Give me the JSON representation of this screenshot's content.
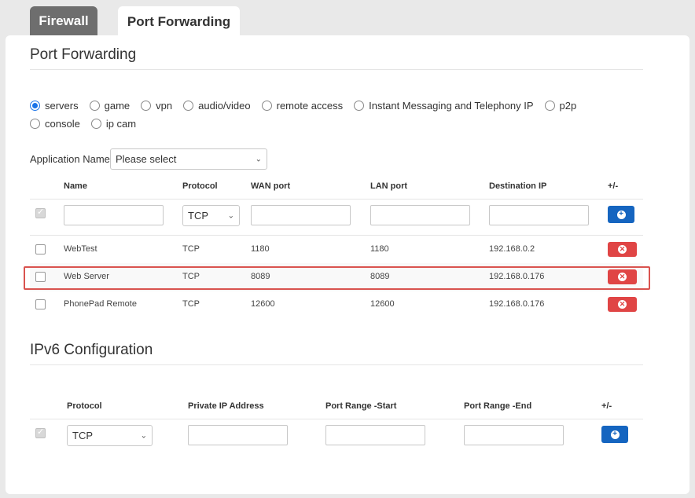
{
  "tabs": [
    {
      "label": "Firewall"
    },
    {
      "label": "Port Forwarding"
    }
  ],
  "port_forwarding": {
    "title": "Port Forwarding",
    "radios_row1": [
      {
        "label": "servers",
        "selected": true
      },
      {
        "label": "game",
        "selected": false
      },
      {
        "label": "vpn",
        "selected": false
      },
      {
        "label": "audio/video",
        "selected": false
      },
      {
        "label": "remote access",
        "selected": false
      },
      {
        "label": "Instant Messaging and Telephony IP",
        "selected": false
      },
      {
        "label": "p2p",
        "selected": false
      }
    ],
    "radios_row2": [
      {
        "label": "console",
        "selected": false
      },
      {
        "label": "ip cam",
        "selected": false
      }
    ],
    "app_name_label": "Application Name",
    "app_name_value": "Please select",
    "headers": [
      "Name",
      "Protocol",
      "WAN port",
      "LAN port",
      "Destination IP",
      "+/-"
    ],
    "new_row_protocol": "TCP",
    "rows": [
      {
        "name": "WebTest",
        "protocol": "TCP",
        "wan": "1180",
        "lan": "1180",
        "ip": "192.168.0.2"
      },
      {
        "name": "Web Server",
        "protocol": "TCP",
        "wan": "8089",
        "lan": "8089",
        "ip": "192.168.0.176"
      },
      {
        "name": "PhonePad Remote",
        "protocol": "TCP",
        "wan": "12600",
        "lan": "12600",
        "ip": "192.168.0.176"
      }
    ]
  },
  "ipv6": {
    "title": "IPv6 Configuration",
    "headers": [
      "Protocol",
      "Private IP Address",
      "Port Range -Start",
      "Port Range -End",
      "+/-"
    ],
    "new_row_protocol": "TCP"
  },
  "colors": {
    "accent_blue": "#1565c0",
    "delete_red": "#e04545",
    "highlight": "#d9534f",
    "radio_blue": "#1a73e8"
  },
  "icons": {
    "add": "plus-circle-icon",
    "delete": "x-circle-icon",
    "select": "chevron-down-icon"
  }
}
